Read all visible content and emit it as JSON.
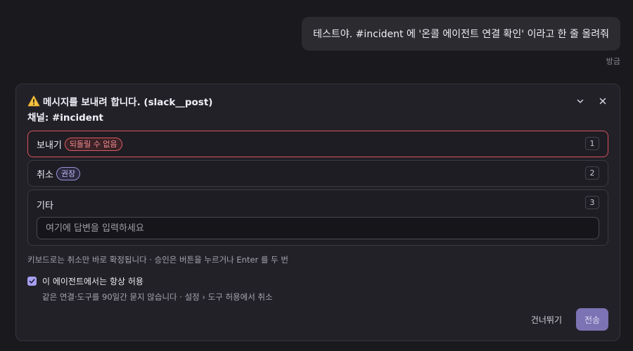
{
  "chat": {
    "user_message": "테스트야. #incident 에 '온콜 에이전트 연결 확인' 이라고 한 줄 올려줘",
    "timestamp": "방금"
  },
  "prompt": {
    "title": "메시지를 보내려 합니다. (slack__post)",
    "channel": "채널: #incident",
    "options": [
      {
        "label": "보내기",
        "badge": "되돌릴 수 없음",
        "number": "1"
      },
      {
        "label": "취소",
        "badge": "권장",
        "number": "2"
      },
      {
        "label": "기타",
        "number": "3",
        "placeholder": "여기에 답변을 입력하세요",
        "value": ""
      }
    ],
    "hint": "키보드로는 취소만 바로 확정됩니다 · 승인은 버튼을 누르거나 Enter 를 두 번",
    "always_allow": {
      "label": "이 에이전트에서는 항상 허용",
      "checked": true,
      "note": "같은 연결·도구를 90일간 묻지 않습니다 · 설정 › 도구 허용에서 취소"
    },
    "skip_label": "건너뛰기",
    "send_label": "전송"
  },
  "colors": {
    "accent": "#a79ff0",
    "danger": "#d9525c",
    "send_button": "#7c73b4"
  }
}
